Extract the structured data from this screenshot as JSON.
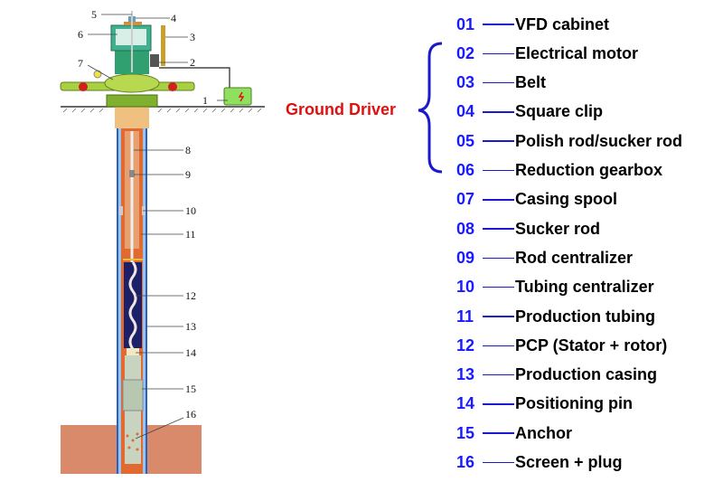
{
  "diagram_labels": [
    "1",
    "2",
    "3",
    "4",
    "5",
    "6",
    "7",
    "8",
    "9",
    "10",
    "11",
    "12",
    "13",
    "14",
    "15",
    "16"
  ],
  "group_label": "Ground Driver",
  "colors": {
    "number": "#1a1aff",
    "group": "#e01010",
    "brace": "#1a1acc"
  },
  "legend": [
    {
      "num": "01",
      "label": "VFD cabinet"
    },
    {
      "num": "02",
      "label": "Electrical motor"
    },
    {
      "num": "03",
      "label": "Belt"
    },
    {
      "num": "04",
      "label": "Square clip"
    },
    {
      "num": "05",
      "label": "Polish rod/sucker rod"
    },
    {
      "num": "06",
      "label": "Reduction gearbox"
    },
    {
      "num": "07",
      "label": "Casing spool"
    },
    {
      "num": "08",
      "label": "Sucker rod"
    },
    {
      "num": "09",
      "label": "Rod centralizer"
    },
    {
      "num": "10",
      "label": "Tubing centralizer"
    },
    {
      "num": "11",
      "label": "Production tubing"
    },
    {
      "num": "12",
      "label": "PCP (Stator + rotor)"
    },
    {
      "num": "13",
      "label": "Production casing"
    },
    {
      "num": "14",
      "label": "Positioning pin"
    },
    {
      "num": "15",
      "label": "Anchor"
    },
    {
      "num": "16",
      "label": "Screen + plug"
    }
  ]
}
